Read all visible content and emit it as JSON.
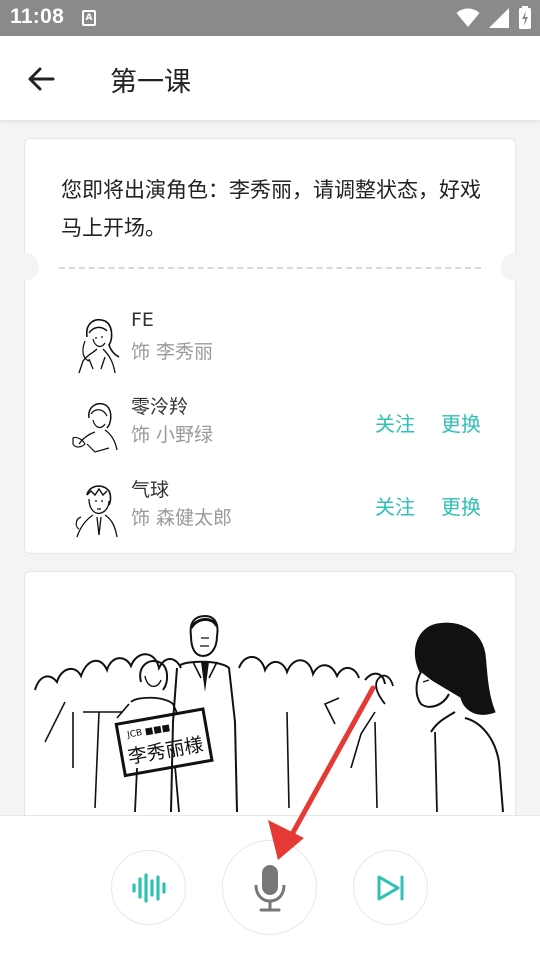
{
  "status_bar": {
    "time": "11:08",
    "notif_glyph": "A"
  },
  "app_bar": {
    "title": "第一课",
    "back_icon": "arrow-left-icon"
  },
  "intro": {
    "message": "您即将出演角色：李秀丽，请调整状态，好戏马上开场。"
  },
  "roles": [
    {
      "name": "FE",
      "as": "饰 李秀丽",
      "follow": "",
      "change": ""
    },
    {
      "name": "零泠羚",
      "as": "饰 小野绿",
      "follow": "关注",
      "change": "更换"
    },
    {
      "name": "气球",
      "as": "饰 森健太郎",
      "follow": "关注",
      "change": "更换"
    }
  ],
  "scene": {
    "sign_text": "李秀丽様"
  },
  "controls": {
    "left_icon": "waveform-icon",
    "center_icon": "microphone-icon",
    "right_icon": "skip-next-icon"
  },
  "colors": {
    "accent": "#2fc1b5",
    "arrow": "#e53935"
  }
}
